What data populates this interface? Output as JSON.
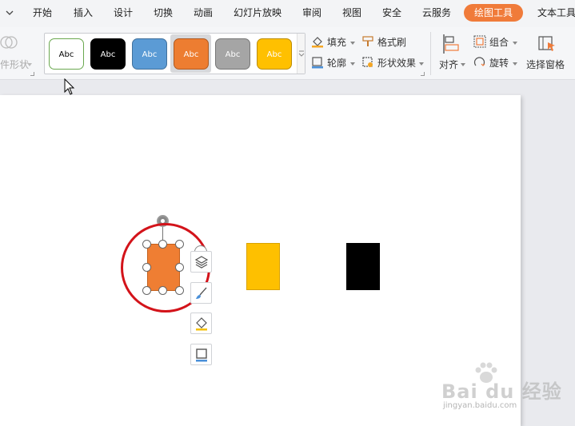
{
  "menu": {
    "items": [
      "开始",
      "插入",
      "设计",
      "切换",
      "动画",
      "幻灯片放映",
      "审阅",
      "视图",
      "安全",
      "云服务"
    ],
    "active": "绘图工具",
    "overflow": "文本工具"
  },
  "ribbon": {
    "left_partial_label": "件形状",
    "gallery": {
      "swatches": [
        {
          "label": "Abc",
          "fill": "#ffffff",
          "border": "#6aa84f",
          "text": "#000000"
        },
        {
          "label": "Abc",
          "fill": "#000000",
          "border": "#000000",
          "text": "#ffffff"
        },
        {
          "label": "Abc",
          "fill": "#5b9bd5",
          "border": "#41719c",
          "text": "#ffffff"
        },
        {
          "label": "Abc",
          "fill": "#ed7d31",
          "border": "#ae5a21",
          "text": "#ffffff"
        },
        {
          "label": "Abc",
          "fill": "#a5a5a5",
          "border": "#787878",
          "text": "#ffffff"
        },
        {
          "label": "Abc",
          "fill": "#ffc000",
          "border": "#bc8c00",
          "text": "#ffffff"
        }
      ],
      "selected_index": 3
    },
    "fill_label": "填充",
    "outline_label": "轮廓",
    "format_painter_label": "格式刷",
    "shape_effects_label": "形状效果",
    "align_label": "对齐",
    "group_label": "组合",
    "rotate_label": "旋转",
    "selection_pane_label": "选择窗格"
  },
  "canvas": {
    "shapes": [
      {
        "name": "orange-rectangle",
        "color": "#ef7e33"
      },
      {
        "name": "yellow-rectangle",
        "color": "#fec000"
      },
      {
        "name": "black-rectangle",
        "color": "#000000"
      }
    ],
    "highlight_color": "#d3131a"
  },
  "watermark": {
    "brand": "Bai du 经验",
    "url": "jingyan.baidu.com"
  },
  "colors": {
    "accent": "#f07b3a"
  }
}
